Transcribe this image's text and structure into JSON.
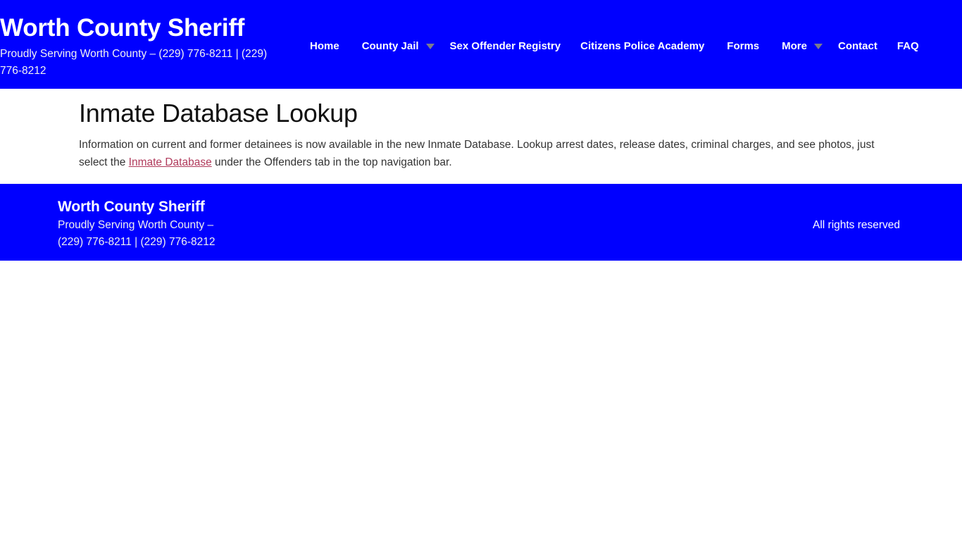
{
  "header": {
    "brand_title": "Worth County Sheriff",
    "brand_tagline": "Proudly Serving Worth County – (229) 776-8211 | (229) 776-8212",
    "nav": [
      {
        "label": "Home",
        "has_caret": false,
        "icon": ""
      },
      {
        "label": "County Jail",
        "has_caret": true,
        "icon": "chevron-down-icon"
      },
      {
        "label": "Sex Offender Registry",
        "has_caret": false,
        "icon": ""
      },
      {
        "label": "Citizens Police Academy",
        "has_caret": false,
        "icon": ""
      },
      {
        "label": "Forms",
        "has_caret": false,
        "icon": ""
      },
      {
        "label": "More",
        "has_caret": true,
        "icon": "chevron-down-icon"
      },
      {
        "label": "Contact",
        "has_caret": false,
        "icon": ""
      },
      {
        "label": "FAQ",
        "has_caret": false,
        "icon": ""
      }
    ]
  },
  "main": {
    "page_title": "Inmate Database Lookup",
    "paragraph_before_link": "Information on current and former detainees is now available in the new Inmate Database. Lookup arrest dates, release dates, criminal charges, and see photos, just select the ",
    "paragraph_link": "Inmate Database",
    "paragraph_after_link": " under the Offenders tab in the top navigation bar."
  },
  "footer": {
    "title": "Worth County Sheriff",
    "line1": "Proudly Serving Worth County –",
    "line2": "(229) 776-8211 | (229) 776-8212",
    "rights": "All rights reserved"
  },
  "colors": {
    "brand_blue": "#0000ff",
    "link_rose": "#b03a5b",
    "caret_gray": "#7c7c8c",
    "page_background": "#ffffff",
    "body_text": "#333333"
  }
}
